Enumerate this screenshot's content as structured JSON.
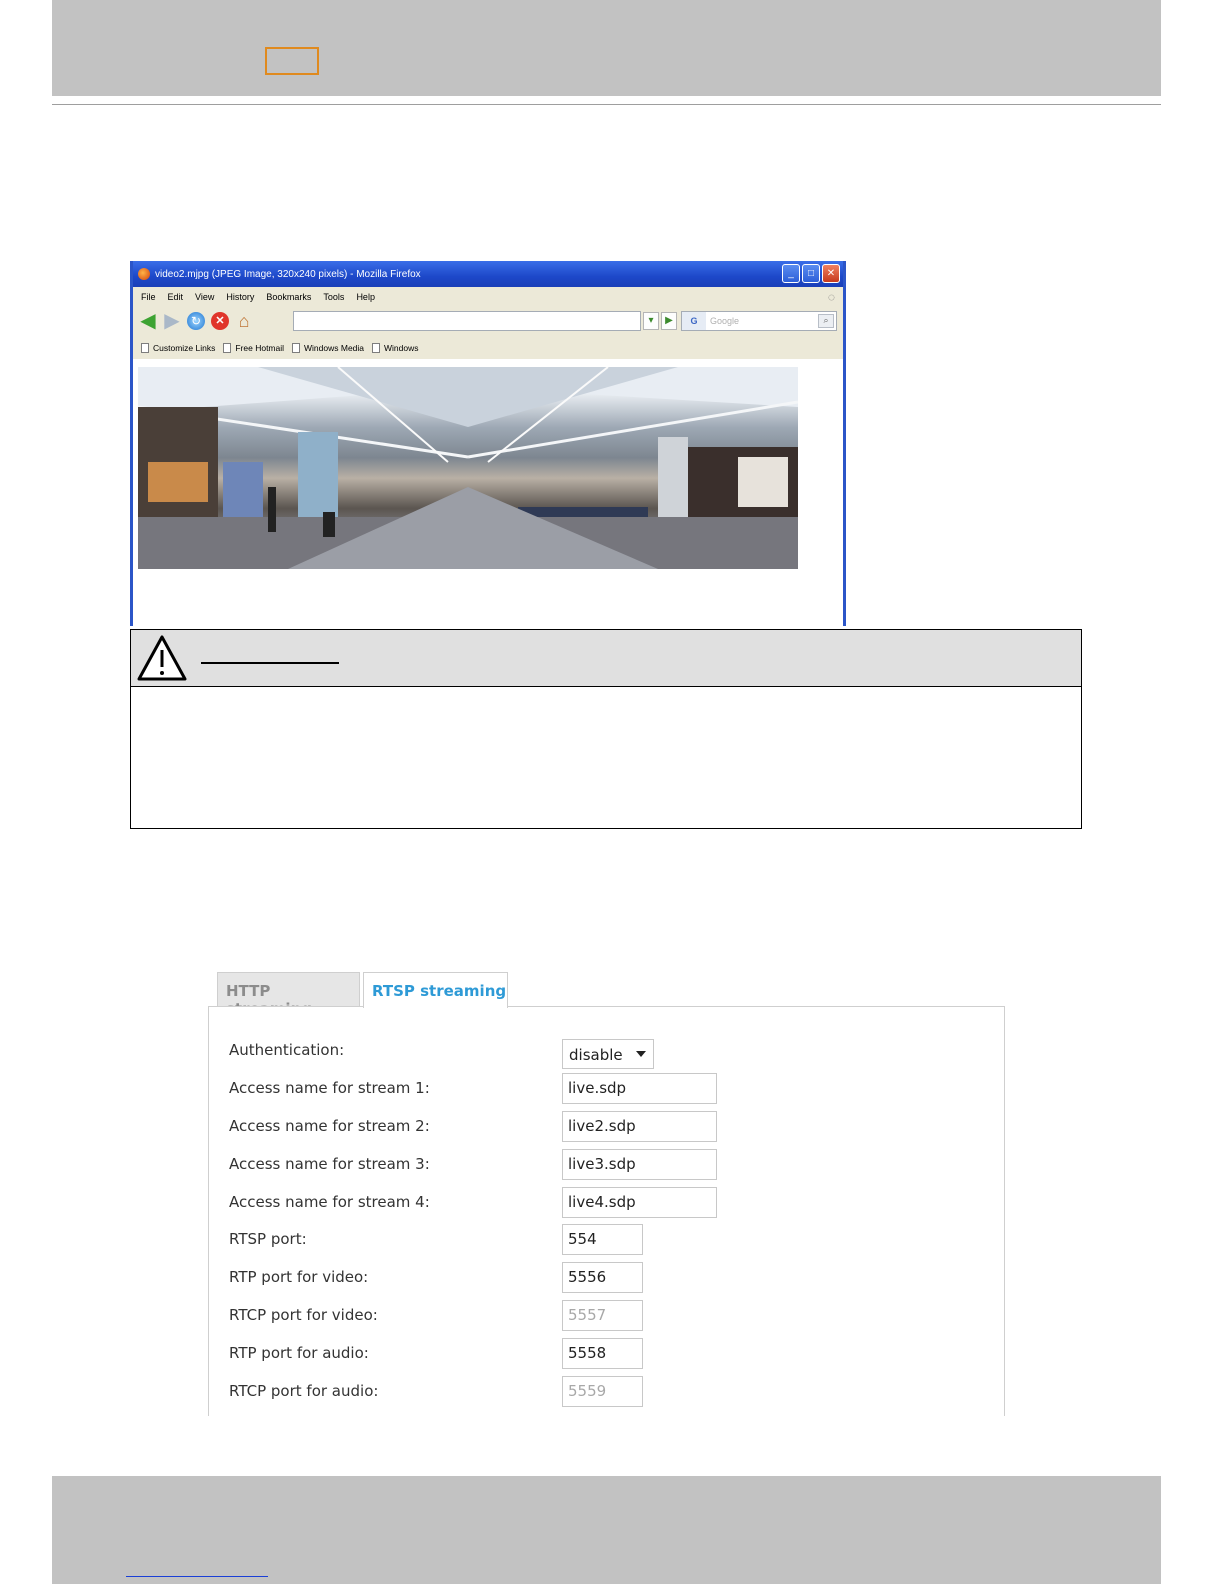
{
  "browser": {
    "window_title": "video2.mjpg (JPEG Image, 320x240 pixels) - Mozilla Firefox",
    "menu": [
      "File",
      "Edit",
      "View",
      "History",
      "Bookmarks",
      "Tools",
      "Help"
    ],
    "search_placeholder": "Google",
    "bookmarks": [
      "Customize Links",
      "Free Hotmail",
      "Windows Media",
      "Windows"
    ]
  },
  "settings": {
    "tabs": {
      "http": "HTTP streaming",
      "rtsp": "RTSP streaming"
    },
    "rows": {
      "authentication": {
        "label": "Authentication:",
        "value": "disable"
      },
      "stream1": {
        "label": "Access name for stream 1:",
        "value": "live.sdp"
      },
      "stream2": {
        "label": "Access name for stream 2:",
        "value": "live2.sdp"
      },
      "stream3": {
        "label": "Access name for stream 3:",
        "value": "live3.sdp"
      },
      "stream4": {
        "label": "Access name for stream 4:",
        "value": "live4.sdp"
      },
      "rtsp_port": {
        "label": "RTSP port:",
        "value": "554"
      },
      "rtp_video": {
        "label": "RTP port for video:",
        "value": "5556"
      },
      "rtcp_video": {
        "label": "RTCP port for video:",
        "value": "5557"
      },
      "rtp_audio": {
        "label": "RTP port for audio:",
        "value": "5558"
      },
      "rtcp_audio": {
        "label": "RTCP port for audio:",
        "value": "5559"
      }
    }
  },
  "colors": {
    "band_gray": "#c2c2c2",
    "active_tab": "#2e9ad6",
    "highlight_box": "#e08a1e"
  }
}
